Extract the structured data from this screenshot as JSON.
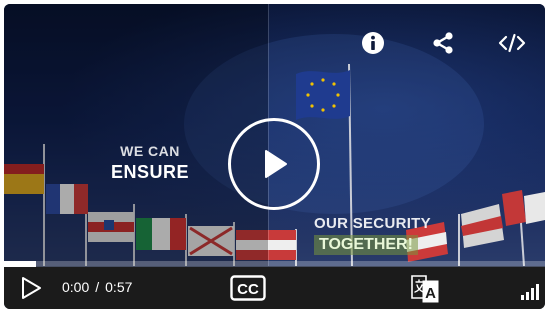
{
  "video": {
    "caption_left": {
      "line1": "WE CAN",
      "line2": "ENSURE"
    },
    "caption_right": {
      "line1": "OUR SECURITY",
      "line2": "TOGETHER!"
    }
  },
  "overlay_icons": [
    "info-icon",
    "share-icon",
    "embed-code-icon"
  ],
  "player": {
    "progress_fraction": 0.06,
    "current_time": "0:00",
    "separator": "/",
    "duration": "0:57",
    "cc_label": "CC",
    "translate_label": "A"
  },
  "colors": {
    "control_bar": "#1b1b1b",
    "scene_dark": "#091433",
    "eu_flag": "#1f3b8f",
    "eu_star": "#f2c200",
    "caption_highlight": "#7a963c"
  }
}
